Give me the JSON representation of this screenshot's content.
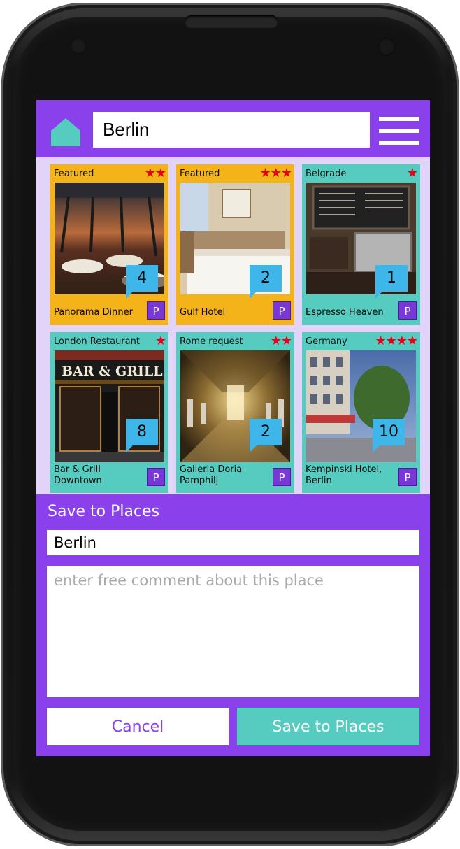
{
  "header": {
    "search_value": "Berlin",
    "icons": {
      "home": "home-icon",
      "menu": "hamburger-menu-icon"
    }
  },
  "cards": [
    {
      "category": "Featured",
      "stars": "★★",
      "rating": 2,
      "count": "4",
      "name": "Panorama Dinner",
      "place_button": "P",
      "color": "#f4b319",
      "photo": "restaurant-photo"
    },
    {
      "category": "Featured",
      "stars": "★★★",
      "rating": 3,
      "count": "2",
      "name": "Gulf Hotel",
      "place_button": "P",
      "color": "#f4b319",
      "photo": "hotel-room-photo"
    },
    {
      "category": "Belgrade",
      "stars": "★",
      "rating": 1,
      "count": "1",
      "name": "Espresso Heaven",
      "place_button": "P",
      "color": "#55ccbf",
      "photo": "coffee-shop-photo"
    },
    {
      "category": "London Restaurant",
      "stars": "★",
      "rating": 1,
      "count": "8",
      "name": "Bar & Grill Downtown",
      "place_button": "P",
      "color": "#55ccbf",
      "photo": "bar-grill-photo"
    },
    {
      "category": "Rome request",
      "stars": "★★",
      "rating": 2,
      "count": "2",
      "name": "Galleria Doria Pamphilj",
      "place_button": "P",
      "color": "#55ccbf",
      "photo": "gallery-hall-photo"
    },
    {
      "category": "Germany",
      "stars": "★★★★",
      "rating": 4,
      "count": "10",
      "name": "Kempinski Hotel, Berlin",
      "place_button": "P",
      "color": "#55ccbf",
      "photo": "hotel-street-photo"
    }
  ],
  "save_panel": {
    "title": "Save to Places",
    "place_name": "Berlin",
    "comment_placeholder": "enter free comment about this place",
    "cancel_label": "Cancel",
    "save_label": "Save to Places"
  },
  "colors": {
    "purple": "#8a41ec",
    "teal": "#55ccbf",
    "orange": "#f4b319",
    "badge_blue": "#3fb6ea",
    "star_red": "#e8001a",
    "grid_background": "#e2d4f8"
  }
}
